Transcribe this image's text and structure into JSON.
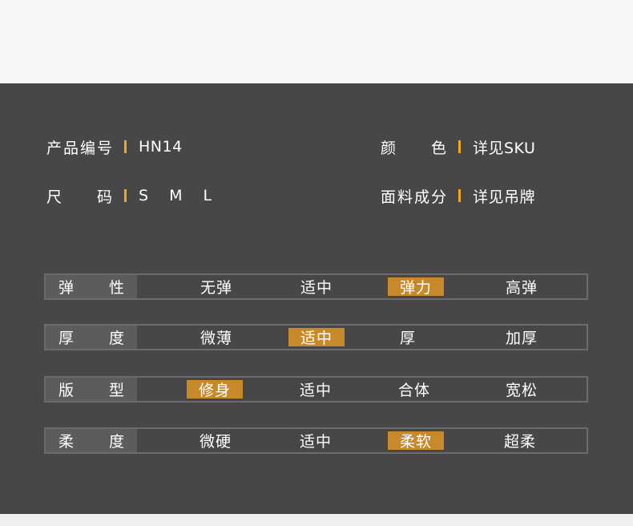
{
  "info": {
    "product_no_label": [
      "产",
      "品",
      "编",
      "号"
    ],
    "product_no_value": "HN14",
    "color_label": [
      "颜",
      "色"
    ],
    "color_value": "详见SKU",
    "size_label": [
      "尺",
      "码"
    ],
    "size_value": "S M L",
    "fabric_label": [
      "面",
      "料",
      "成",
      "分"
    ],
    "fabric_value": "详见吊牌"
  },
  "accent_color": "#f2a81d",
  "highlight_color": "#c8892a",
  "attributes": [
    {
      "label": [
        "弹",
        "性"
      ],
      "options": [
        "无弹",
        "适中",
        "弹力",
        "高弹"
      ],
      "selected": 2
    },
    {
      "label": [
        "厚",
        "度"
      ],
      "options": [
        "微薄",
        "适中",
        "厚",
        "加厚"
      ],
      "selected": 1
    },
    {
      "label": [
        "版",
        "型"
      ],
      "options": [
        "修身",
        "适中",
        "合体",
        "宽松"
      ],
      "selected": 0
    },
    {
      "label": [
        "柔",
        "度"
      ],
      "options": [
        "微硬",
        "适中",
        "柔软",
        "超柔"
      ],
      "selected": 2
    }
  ]
}
